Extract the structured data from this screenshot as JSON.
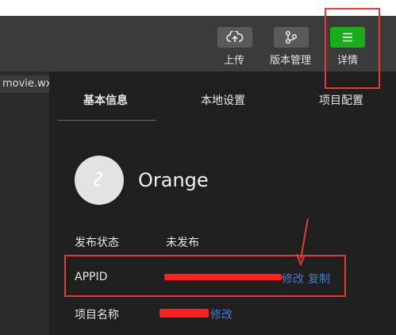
{
  "toolbar": {
    "upload_label": "上传",
    "version_label": "版本管理",
    "details_label": "详情"
  },
  "editor": {
    "file_tab_label": "movie.wx"
  },
  "details_panel": {
    "tabs": [
      "基本信息",
      "本地设置",
      "项目配置"
    ],
    "project_name": "Orange",
    "rows": {
      "publish_status": {
        "label": "发布状态",
        "value": "未发布"
      },
      "appid": {
        "label": "APPID",
        "modify": "修改",
        "copy": "复制"
      },
      "project_name_row": {
        "label": "项目名称",
        "modify": "修改"
      }
    }
  },
  "colors": {
    "annotation_red": "#e53935",
    "link_blue": "#4a78c6",
    "accent_green": "#1aad19"
  },
  "icons": {
    "upload": "cloud-upload-icon",
    "version": "git-branch-icon",
    "details": "menu-lines-icon",
    "avatar": "mini-program-icon"
  }
}
